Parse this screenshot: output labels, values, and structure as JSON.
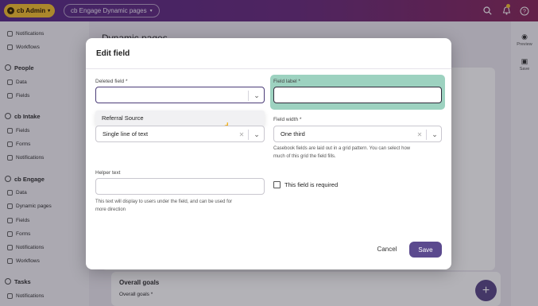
{
  "topbar": {
    "admin_label": "cb Admin",
    "engage_label": "cb Engage Dynamic pages"
  },
  "sidebar": {
    "items": [
      {
        "label": "Notifications",
        "type": "sub"
      },
      {
        "label": "Workflows",
        "type": "sub"
      },
      {
        "label": "People",
        "type": "head"
      },
      {
        "label": "Data",
        "type": "sub"
      },
      {
        "label": "Fields",
        "type": "sub"
      },
      {
        "label": "cb Intake",
        "type": "head"
      },
      {
        "label": "Fields",
        "type": "sub"
      },
      {
        "label": "Forms",
        "type": "sub"
      },
      {
        "label": "Notifications",
        "type": "sub"
      },
      {
        "label": "cb Engage",
        "type": "head"
      },
      {
        "label": "Data",
        "type": "sub"
      },
      {
        "label": "Dynamic pages",
        "type": "sub"
      },
      {
        "label": "Fields",
        "type": "sub"
      },
      {
        "label": "Forms",
        "type": "sub"
      },
      {
        "label": "Notifications",
        "type": "sub"
      },
      {
        "label": "Workflows",
        "type": "sub"
      },
      {
        "label": "Tasks",
        "type": "head"
      },
      {
        "label": "Notifications",
        "type": "sub"
      }
    ]
  },
  "right_rail": {
    "preview_label": "Preview",
    "save_label": "Save"
  },
  "background": {
    "page_title": "Dynamic pages",
    "card_title": "Overall goals",
    "card_field_label": "Overall goals *"
  },
  "modal": {
    "title": "Edit field",
    "deleted_field_label": "Deleted field *",
    "deleted_field_value": "",
    "dropdown_option": "Referral Source",
    "field_type_value": "Single line of text",
    "field_label_label": "Field label *",
    "field_label_value": "",
    "field_width_label": "Field width *",
    "field_width_value": "One third",
    "field_width_help_1": "Casebook fields are laid out in a grid pattern. You can select how",
    "field_width_help_2": "much of this grid the field fills.",
    "helper_text_label": "Helper text",
    "helper_text_value": "",
    "helper_text_help_1": "This text will display to users under the field, and can be used for",
    "helper_text_help_2": "more direction",
    "required_label": "This field is required",
    "required_checked": false,
    "cancel_label": "Cancel",
    "save_label": "Save"
  },
  "colors": {
    "topbar_start": "#5a2f8a",
    "topbar_end": "#8a2a5c",
    "admin_badge": "#f4c233",
    "primary_button": "#5b4a8e",
    "highlight": "#9dd2c0"
  }
}
